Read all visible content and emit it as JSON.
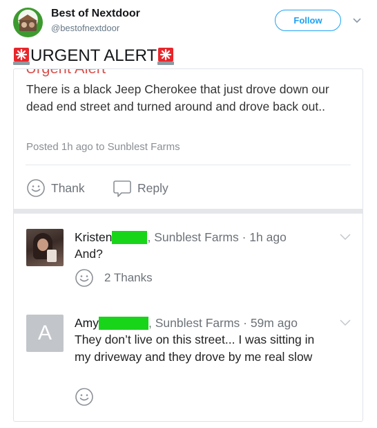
{
  "tweet": {
    "author_name": "Best of Nextdoor",
    "author_handle": "@bestofnextdoor",
    "follow_label": "Follow",
    "text": "URGENT ALERT"
  },
  "card": {
    "cut_title": "Urgent Alert",
    "body": "There is a black Jeep Cherokee that just drove down our dead end street and turned around and drove back out..",
    "meta": "Posted 1h ago to Sunblest Farms",
    "thank_label": "Thank",
    "reply_label": "Reply"
  },
  "comments": [
    {
      "name": "Kristen",
      "location": ", Sunblest Farms · 1h ago",
      "text": "And?",
      "thanks": "2 Thanks"
    },
    {
      "name": "Amy",
      "avatar_letter": "A",
      "location": ", Sunblest Farms · 59m ago",
      "text": "They don’t live on this street... I was sitting in my driveway and they drove by me real slow"
    }
  ],
  "colors": {
    "twitter_blue": "#1da1f2",
    "alert_red": "#d9534f",
    "redaction_green": "#18d51a",
    "muted_text": "#6c7278"
  },
  "icons": [
    "siren-icon",
    "chevron-down-icon",
    "smiley-icon",
    "speech-bubble-icon"
  ]
}
